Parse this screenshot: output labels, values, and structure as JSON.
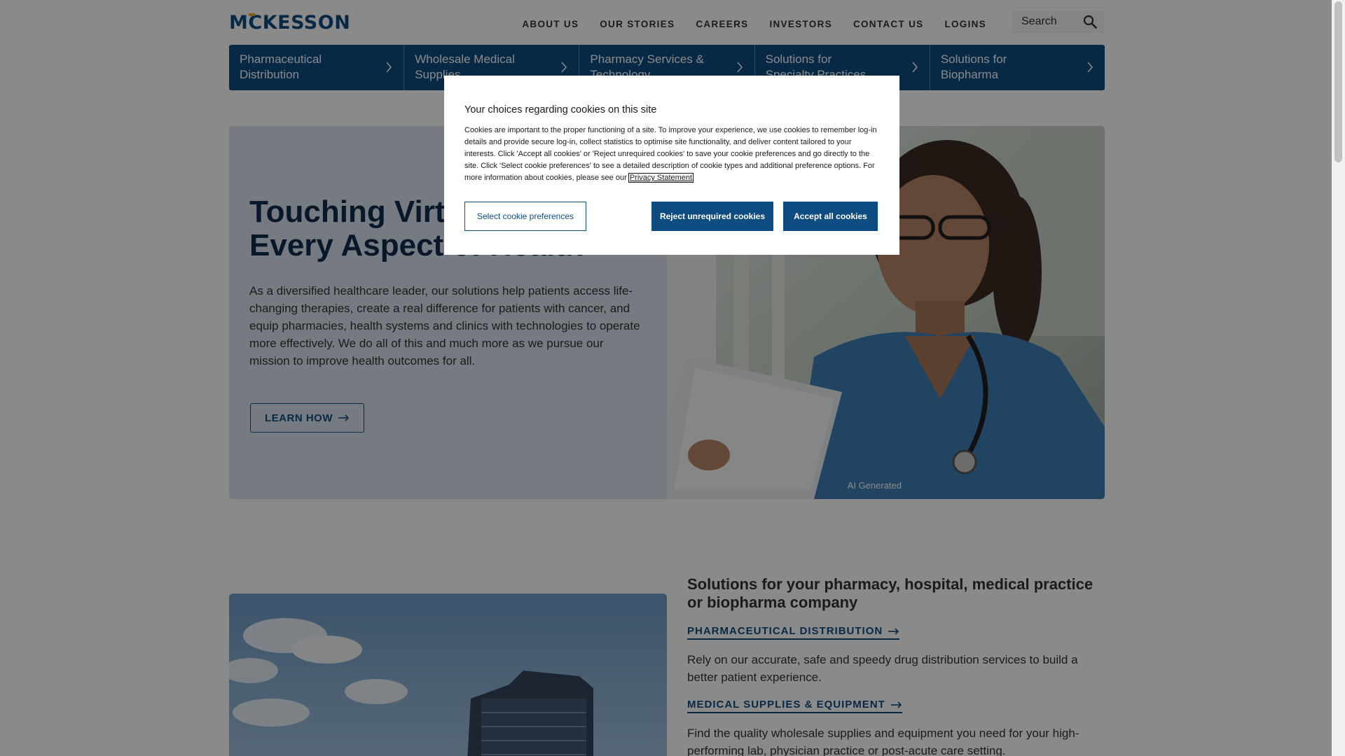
{
  "brand": {
    "logo_text": "MCKESSON",
    "accent_color": "#0f4c81",
    "logo_accent_color": "#f2a900"
  },
  "topnav": {
    "items": [
      "ABOUT US",
      "OUR STORIES",
      "CAREERS",
      "INVESTORS",
      "CONTACT US",
      "LOGINS"
    ],
    "search_placeholder": "Search"
  },
  "category_nav": {
    "items": [
      {
        "line1": "Pharmaceutical",
        "line2": "Distribution"
      },
      {
        "line1": "Wholesale Medical",
        "line2": "Supplies"
      },
      {
        "line1": "Pharmacy Services &",
        "line2": "Technology"
      },
      {
        "line1": "Solutions for",
        "line2": "Specialty Practices"
      },
      {
        "line1": "Solutions for",
        "line2": "Biopharma"
      }
    ]
  },
  "hero": {
    "title_line1": "Touching Virtually",
    "title_line2": "Every Aspect of Health",
    "body": "As a diversified healthcare leader, our solutions help patients access life-changing therapies, create a real difference for patients with cancer, and equip pharmacies, health systems and clinics with technologies to operate more effectively. We do all of this and much more as we pursue our mission to improve health outcomes for all.",
    "button": "LEARN HOW",
    "image_caption": "AI Generated"
  },
  "solutions": {
    "heading": "Solutions for your pharmacy, hospital, medical practice or biopharma company",
    "links": [
      {
        "label": "PHARMACEUTICAL DISTRIBUTION",
        "text": "Rely on our accurate, safe and speedy drug distribution services to build a better patient experience."
      },
      {
        "label": "MEDICAL SUPPLIES & EQUIPMENT",
        "text": "Find the quality wholesale supplies and equipment you need for your high-performing lab, physician practice or post-acute care setting."
      }
    ]
  },
  "cookie_modal": {
    "title": "Your choices regarding cookies on this site",
    "body": "Cookies are important to the proper functioning of a site. To improve your experience, we use cookies to remember log-in details and provide secure log-in, collect statistics to optimise site functionality, and deliver content tailored to your interests. Click 'Accept all cookies' or 'Reject unrequired cookies' to save your cookie preferences and go directly to the site. Click 'Select cookie preferences' to see a detailed description of cookie types and additional preference options. For more information about cookies, please see our",
    "privacy_link": "Privacy Statement",
    "btn_select": "Select cookie preferences",
    "btn_reject": "Reject unrequired cookies",
    "btn_accept": "Accept all cookies"
  }
}
